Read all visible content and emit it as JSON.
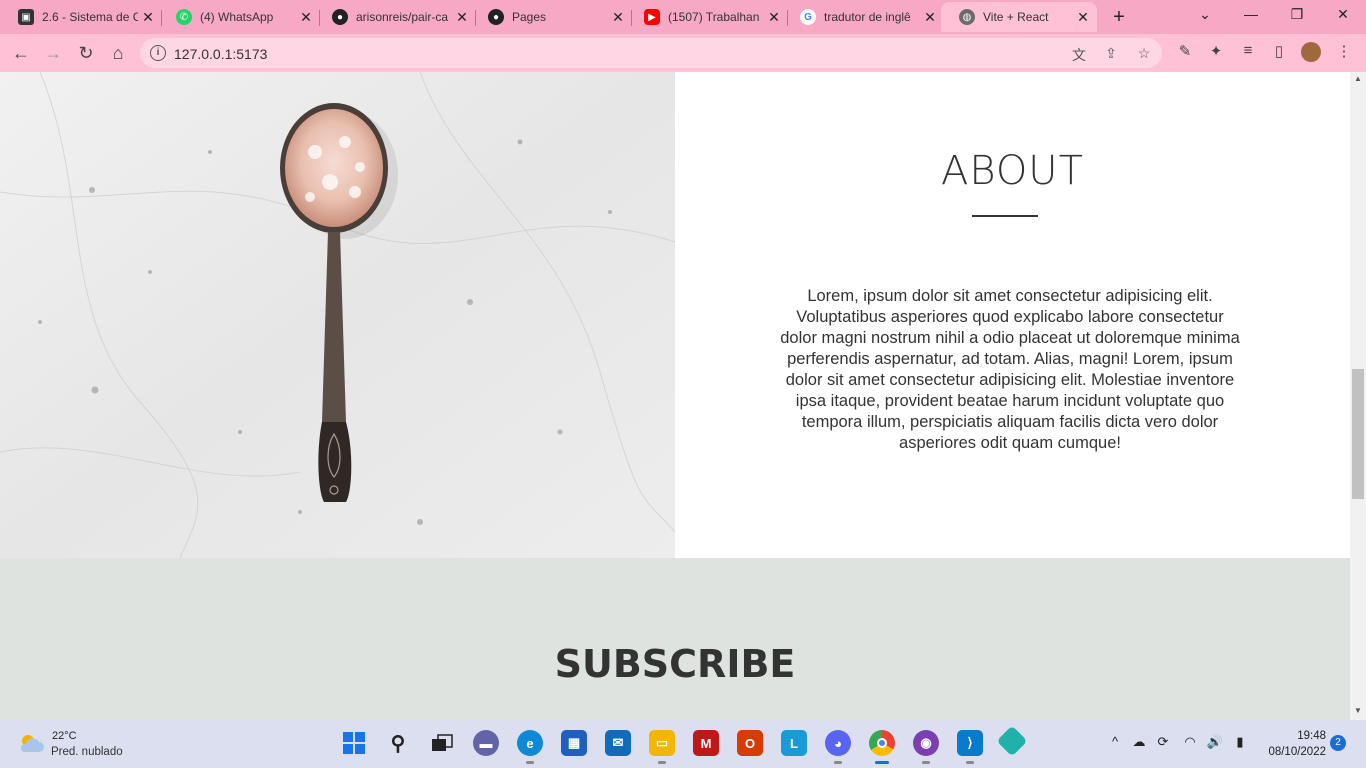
{
  "browser": {
    "tabs": [
      {
        "title": "2.6 - Sistema de C",
        "icon": "contact-card-icon",
        "color": "#333333",
        "active": false
      },
      {
        "title": "(4) WhatsApp",
        "icon": "whatsapp-icon",
        "color": "#25d366",
        "active": false
      },
      {
        "title": "arisonreis/pair-ca",
        "icon": "github-icon",
        "color": "#222222",
        "active": false
      },
      {
        "title": "Pages",
        "icon": "github-icon",
        "color": "#222222",
        "active": false
      },
      {
        "title": "(1507) Trabalhan",
        "icon": "youtube-icon",
        "color": "#ff0000",
        "active": false
      },
      {
        "title": "tradutor de inglê",
        "icon": "google-icon",
        "color": "#4285f4",
        "active": false
      },
      {
        "title": "Vite + React",
        "icon": "globe-icon",
        "color": "#6b6b6b",
        "active": true
      }
    ],
    "url": "127.0.0.1:5173",
    "tab_bar_color": "#f7a8c4",
    "toolbar_color": "#ffc1d6"
  },
  "page": {
    "about": {
      "title": "ABOUT",
      "body": "Lorem, ipsum dolor sit amet consectetur adipisicing elit. Voluptatibus asperiores quod explicabo labore consectetur dolor magni nostrum nihil a odio placeat ut doloremque minima perferendis aspernatur, ad totam. Alias, magni! Lorem, ipsum dolor sit amet consectetur adipisicing elit. Molestiae inventore ipsa itaque, provident beatae harum incidunt voluptate quo tempora illum, perspiciatis aliquam facilis dicta vero dolor asperiores odit quam cumque!",
      "image": "salt-spoon-on-marble-image"
    },
    "subscribe": {
      "title": "SUBSCRIBE",
      "background": "#dfe3df"
    }
  },
  "taskbar": {
    "weather": {
      "temp": "22°C",
      "condition": "Pred. nublado"
    },
    "apps": [
      {
        "name": "windows-start-icon",
        "color": "#1a73e8"
      },
      {
        "name": "search-icon",
        "color": "#222222"
      },
      {
        "name": "task-view-icon",
        "color": "#222222"
      },
      {
        "name": "teams-chat-icon",
        "color": "#6264a7"
      },
      {
        "name": "edge-icon",
        "color": "#0c8ad6"
      },
      {
        "name": "store-icon",
        "color": "#1e5fbf"
      },
      {
        "name": "mail-icon",
        "color": "#0f6cbd"
      },
      {
        "name": "file-explorer-icon",
        "color": "#f2b705"
      },
      {
        "name": "mcafee-icon",
        "color": "#c01818"
      },
      {
        "name": "office-icon",
        "color": "#d83b01"
      },
      {
        "name": "l-app-icon",
        "color": "#1a9bd7"
      },
      {
        "name": "discord-icon",
        "color": "#5865f2"
      },
      {
        "name": "chrome-icon",
        "color": "#ea4335"
      },
      {
        "name": "github-desktop-icon",
        "color": "#7b3fb0"
      },
      {
        "name": "vscode-icon",
        "color": "#0a7acc"
      },
      {
        "name": "gitkraken-icon",
        "color": "#20b2aa"
      }
    ],
    "time": "19:48",
    "date": "08/10/2022",
    "notifications": "2"
  }
}
